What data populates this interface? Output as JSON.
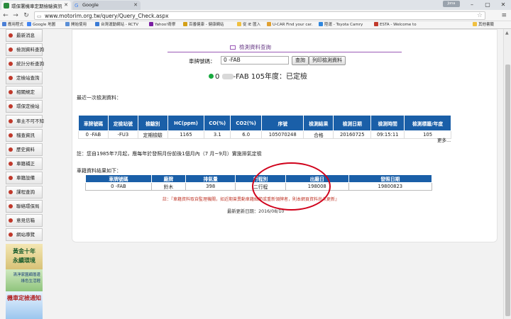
{
  "browser": {
    "tabs": [
      {
        "title": "環保署機車定期檢驗資訊",
        "active": true
      },
      {
        "title": "Google",
        "active": false
      }
    ],
    "user_badge": "Jona",
    "url": "www.motorim.org.tw/query/Query_Check.aspx",
    "bookmarks": [
      "應用程式",
      "Google 地圖",
      "開始使用",
      "台灣運動網站 - RCTV",
      "Yahoo!奇摩",
      "百番健康 - 健康網站",
      "從 IE 匯入",
      "U-CAR Find your car.",
      "陸運 - Toyota Camry",
      "ESTA - Welcome to",
      "其他書籤"
    ],
    "bookmark_colors": [
      "#4a7fd6",
      "#4285f4",
      "#5b8fd6",
      "#3a7bd5",
      "#7b1fa2",
      "#d4a017",
      "#f0c040",
      "#e0a030",
      "#2e86de",
      "#c0392b",
      "#f0c040"
    ]
  },
  "sidebar": {
    "items": [
      "最新消息",
      "檢測資料查詢",
      "統計分析查詢",
      "定檢站查詢",
      "相關規定",
      "環保定檢站",
      "車主不可不知",
      "稽查資訊",
      "歷史資料",
      "車籍補正",
      "車籍設備",
      "課程查詢",
      "聯絡環保局",
      "意見信箱",
      "網站導覽"
    ]
  },
  "ads": {
    "ad1_line1": "黃金十年",
    "ad1_line2": "永續環境",
    "ad2_line1": "清淨家園顧厝邊",
    "ad2_line2": "綠色生活輕",
    "ad3": "機車定檢通知"
  },
  "query": {
    "title": "檢測資料查詢",
    "plate_label": "車牌號碼：",
    "plate_value": "0 -FAB",
    "query_button": "查詢",
    "print_button": "列印檢測資料"
  },
  "status": {
    "plate_prefix": "0",
    "plate_suffix": "-FAB",
    "text": "105年度：已定檢"
  },
  "inspection": {
    "label": "最近一次檢測資料：",
    "headers": [
      "車牌號碼",
      "定檢站號",
      "檢驗別",
      "HC(ppm)",
      "CO(%)",
      "CO2(%)",
      "序號",
      "檢測結果",
      "檢測日期",
      "檢測時間",
      "檢測標籤/年度"
    ],
    "row": [
      "0 -FAB",
      "-FU3",
      "定期檢驗",
      "1165",
      "3.1",
      "6.0",
      "105070248",
      "合格",
      "20160725",
      "09:15:11",
      "105"
    ],
    "more": "更多..."
  },
  "note": "註：您自1985年7月起，應每年於發照月份前後1個月內（7 月~9月）實施排氣定檢",
  "registration": {
    "label": "車籍資料結果如下：",
    "headers": [
      "車牌號碼",
      "廠牌",
      "排氣量",
      "行程別",
      "出廠日",
      "發照日期"
    ],
    "row": [
      "0 -FAB",
      "鈴木",
      "398",
      "二行程",
      "198008",
      "19800823"
    ]
  },
  "warning": "註：『車籍資料取自監理機關，如近期曾異動車籍細節或重新領牌者，則本網頁資料尚未更新』",
  "updated": "最新更新日期：2016/08/10"
}
